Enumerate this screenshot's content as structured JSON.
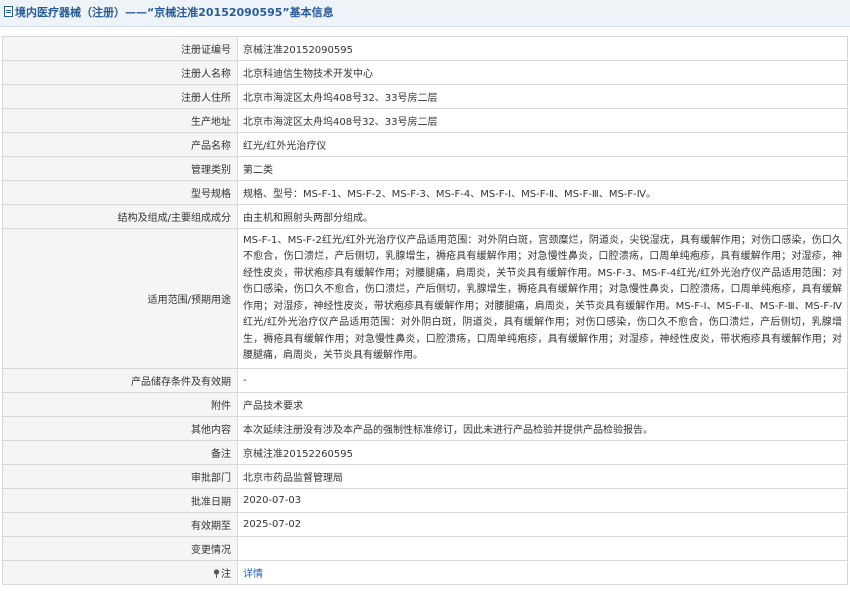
{
  "header": {
    "title": "境内医疗器械（注册）——“京械注准20152090595”基本信息"
  },
  "rows": [
    {
      "label": "注册证编号",
      "value": "京械注准20152090595"
    },
    {
      "label": "注册人名称",
      "value": "北京科迪信生物技术开发中心"
    },
    {
      "label": "注册人住所",
      "value": "北京市海淀区太舟坞408号32、33号房二层"
    },
    {
      "label": "生产地址",
      "value": "北京市海淀区太舟坞408号32、33号房二层"
    },
    {
      "label": "产品名称",
      "value": "红光/红外光治疗仪"
    },
    {
      "label": "管理类别",
      "value": "第二类"
    },
    {
      "label": "型号规格",
      "value": "规格、型号：MS-F-1、MS-F-2、MS-F-3、MS-F-4、MS-F-Ⅰ、MS-F-Ⅱ、MS-F-Ⅲ、MS-F-Ⅳ。"
    },
    {
      "label": "结构及组成/主要组成成分",
      "value": "由主机和照射头两部分组成。"
    },
    {
      "label": "适用范围/预期用途",
      "value": "MS-F-1、MS-F-2红光/红外光治疗仪产品适用范围：对外阴白斑，宫颈糜烂，阴道炎，尖锐湿疣，具有缓解作用；对伤口感染，伤口久不愈合，伤口溃烂，产后侧切，乳腺增生，褥疮具有缓解作用；对急慢性鼻炎，口腔溃疡，口周单纯疱疹，具有缓解作用；对湿疹，神经性皮炎，带状疱疹具有缓解作用；对腰腿痛，肩周炎，关节炎具有缓解作用。MS-F-3、MS-F-4红光/红外光治疗仪产品适用范围：对伤口感染，伤口久不愈合，伤口溃烂，产后侧切，乳腺增生，褥疮具有缓解作用；对急慢性鼻炎，口腔溃疡，口周单纯疱疹，具有缓解作用；对湿疹，神经性皮炎，带状疱疹具有缓解作用；对腰腿痛，肩周炎，关节炎具有缓解作用。MS-F-Ⅰ、MS-F-Ⅱ、MS-F-Ⅲ、MS-F-Ⅳ红光/红外光治疗仪产品适用范围：对外阴白斑，阴道炎，具有缓解作用；对伤口感染，伤口久不愈合，伤口溃烂，产后侧切，乳腺增生，褥疮具有缓解作用；对急慢性鼻炎，口腔溃疡，口周单纯疱疹，具有缓解作用；对湿疹，神经性皮炎，带状疱疹具有缓解作用；对腰腿痛，肩周炎，关节炎具有缓解作用。"
    },
    {
      "label": "产品储存条件及有效期",
      "value": "-"
    },
    {
      "label": "附件",
      "value": "产品技术要求"
    },
    {
      "label": "其他内容",
      "value": "本次延续注册没有涉及本产品的强制性标准修订，因此未进行产品检验并提供产品检验报告。"
    },
    {
      "label": "备注",
      "value": "京械注准20152260595"
    },
    {
      "label": "审批部门",
      "value": "北京市药品监督管理局"
    },
    {
      "label": "批准日期",
      "value": "2020-07-03"
    },
    {
      "label": "有效期至",
      "value": "2025-07-02"
    },
    {
      "label": "变更情况",
      "value": ""
    },
    {
      "label": "注",
      "value": "详情"
    }
  ],
  "icons": {
    "title": "document-icon",
    "note": "pin-icon"
  },
  "colors": {
    "title_text": "#2a5d97",
    "title_bg": "#eef3f8",
    "label_bg": "#f5f5f5",
    "border": "#d8d8d8",
    "link": "#1f5fbf"
  }
}
